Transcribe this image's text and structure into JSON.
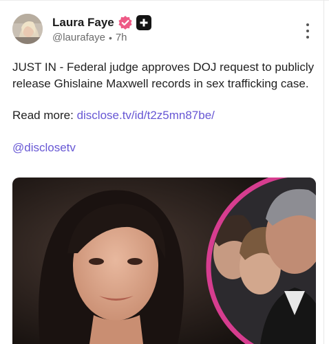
{
  "author": {
    "name": "Laura Faye",
    "handle": "@laurafaye",
    "separator": "•",
    "time": "7h",
    "verified_color": "#ee5a86"
  },
  "post": {
    "text": "JUST IN - Federal judge approves DOJ request to publicly release Ghislaine Maxwell records in sex trafficking case.",
    "read_more_label": "Read more:",
    "read_more_link": "disclose.tv/id/t2z5mn87be/",
    "mention": "@disclosetv"
  },
  "theme": {
    "link_color": "#6757d4",
    "media_ring_color": "#d63d8f"
  },
  "icons": [
    "verified-badge-icon",
    "plus-badge-icon",
    "more-options-icon"
  ]
}
